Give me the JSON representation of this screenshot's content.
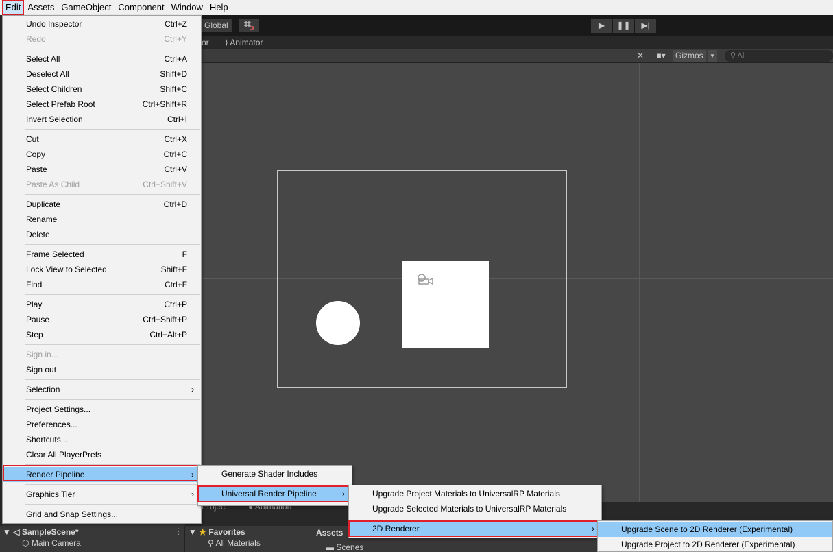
{
  "menubar": {
    "items": [
      "Edit",
      "Assets",
      "GameObject",
      "Component",
      "Window",
      "Help"
    ]
  },
  "toolbar": {
    "global_label": "Global",
    "play_icon": "▶",
    "pause_icon": "❚❚",
    "step_icon": "▶|"
  },
  "tabs": {
    "animator": "Animator",
    "partial": "or"
  },
  "scene_toolbar": {
    "gizmos": "Gizmos",
    "search_placeholder": "All"
  },
  "edit_menu": {
    "undo": {
      "label": "Undo Inspector",
      "shortcut": "Ctrl+Z"
    },
    "redo": {
      "label": "Redo",
      "shortcut": "Ctrl+Y"
    },
    "select_all": {
      "label": "Select All",
      "shortcut": "Ctrl+A"
    },
    "deselect_all": {
      "label": "Deselect All",
      "shortcut": "Shift+D"
    },
    "select_children": {
      "label": "Select Children",
      "shortcut": "Shift+C"
    },
    "select_prefab_root": {
      "label": "Select Prefab Root",
      "shortcut": "Ctrl+Shift+R"
    },
    "invert_selection": {
      "label": "Invert Selection",
      "shortcut": "Ctrl+I"
    },
    "cut": {
      "label": "Cut",
      "shortcut": "Ctrl+X"
    },
    "copy": {
      "label": "Copy",
      "shortcut": "Ctrl+C"
    },
    "paste": {
      "label": "Paste",
      "shortcut": "Ctrl+V"
    },
    "paste_as_child": {
      "label": "Paste As Child",
      "shortcut": "Ctrl+Shift+V"
    },
    "duplicate": {
      "label": "Duplicate",
      "shortcut": "Ctrl+D"
    },
    "rename": {
      "label": "Rename"
    },
    "delete": {
      "label": "Delete"
    },
    "frame_selected": {
      "label": "Frame Selected",
      "shortcut": "F"
    },
    "lock_view": {
      "label": "Lock View to Selected",
      "shortcut": "Shift+F"
    },
    "find": {
      "label": "Find",
      "shortcut": "Ctrl+F"
    },
    "play": {
      "label": "Play",
      "shortcut": "Ctrl+P"
    },
    "pause": {
      "label": "Pause",
      "shortcut": "Ctrl+Shift+P"
    },
    "step": {
      "label": "Step",
      "shortcut": "Ctrl+Alt+P"
    },
    "sign_in": {
      "label": "Sign in..."
    },
    "sign_out": {
      "label": "Sign out"
    },
    "selection": {
      "label": "Selection"
    },
    "project_settings": {
      "label": "Project Settings..."
    },
    "preferences": {
      "label": "Preferences..."
    },
    "shortcuts": {
      "label": "Shortcuts..."
    },
    "clear_playerprefs": {
      "label": "Clear All PlayerPrefs"
    },
    "render_pipeline": {
      "label": "Render Pipeline"
    },
    "graphics_tier": {
      "label": "Graphics Tier"
    },
    "grid_snap": {
      "label": "Grid and Snap Settings..."
    }
  },
  "render_pipeline_menu": {
    "generate_shader": "Generate Shader Includes",
    "urp": "Universal Render Pipeline"
  },
  "urp_menu": {
    "upgrade_project_materials": "Upgrade Project Materials to UniversalRP Materials",
    "upgrade_selected_materials": "Upgrade Selected Materials to UniversalRP Materials",
    "renderer_2d": "2D Renderer"
  },
  "renderer_2d_menu": {
    "upgrade_scene": "Upgrade Scene to 2D Renderer (Experimental)",
    "upgrade_project": "Upgrade Project to 2D Renderer (Experimental)"
  },
  "bottom": {
    "project_tab": "Project",
    "animation_tab": "Animation",
    "scene_name": "SampleScene*",
    "main_camera": "Main Camera",
    "favorites": "Favorites",
    "all_materials": "All Materials",
    "assets": "Assets",
    "scenes": "Scenes"
  },
  "colors": {
    "highlight": "#91c9f7",
    "red_outline": "#e0202a"
  }
}
